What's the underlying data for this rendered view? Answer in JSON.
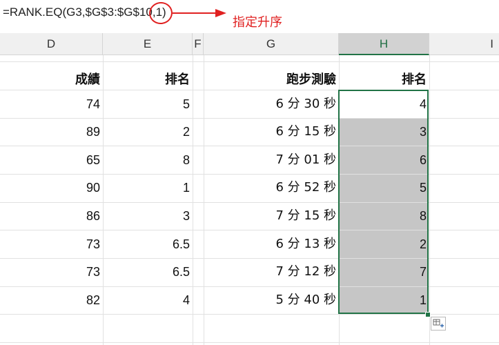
{
  "formula_bar": {
    "formula": "=RANK.EQ(G3,$G$3:$G$10,1)"
  },
  "annotation": {
    "label": "指定升序",
    "color": "#e02020"
  },
  "columns": [
    "D",
    "E",
    "F",
    "G",
    "H",
    "I"
  ],
  "active_column": "H",
  "headers": {
    "d": "成績",
    "e": "排名",
    "g": "跑步測驗",
    "h": "排名"
  },
  "rows": [
    {
      "d": "74",
      "e": "5",
      "g": "6 分 30 秒",
      "h": "4"
    },
    {
      "d": "89",
      "e": "2",
      "g": "6 分 15 秒",
      "h": "3"
    },
    {
      "d": "65",
      "e": "8",
      "g": "7 分 01 秒",
      "h": "6"
    },
    {
      "d": "90",
      "e": "1",
      "g": "6 分 52 秒",
      "h": "5"
    },
    {
      "d": "86",
      "e": "3",
      "g": "7 分 15 秒",
      "h": "8"
    },
    {
      "d": "73",
      "e": "6.5",
      "g": "6 分 13 秒",
      "h": "2"
    },
    {
      "d": "73",
      "e": "6.5",
      "g": "7 分 12 秒",
      "h": "7"
    },
    {
      "d": "82",
      "e": "4",
      "g": "5 分 40 秒",
      "h": "1"
    }
  ],
  "colors": {
    "selection_border": "#217346",
    "selection_fill": "#c6c6c6",
    "header_bg": "#f0f0f0"
  },
  "icons": {
    "quick_analysis": "quick-analysis-icon"
  }
}
